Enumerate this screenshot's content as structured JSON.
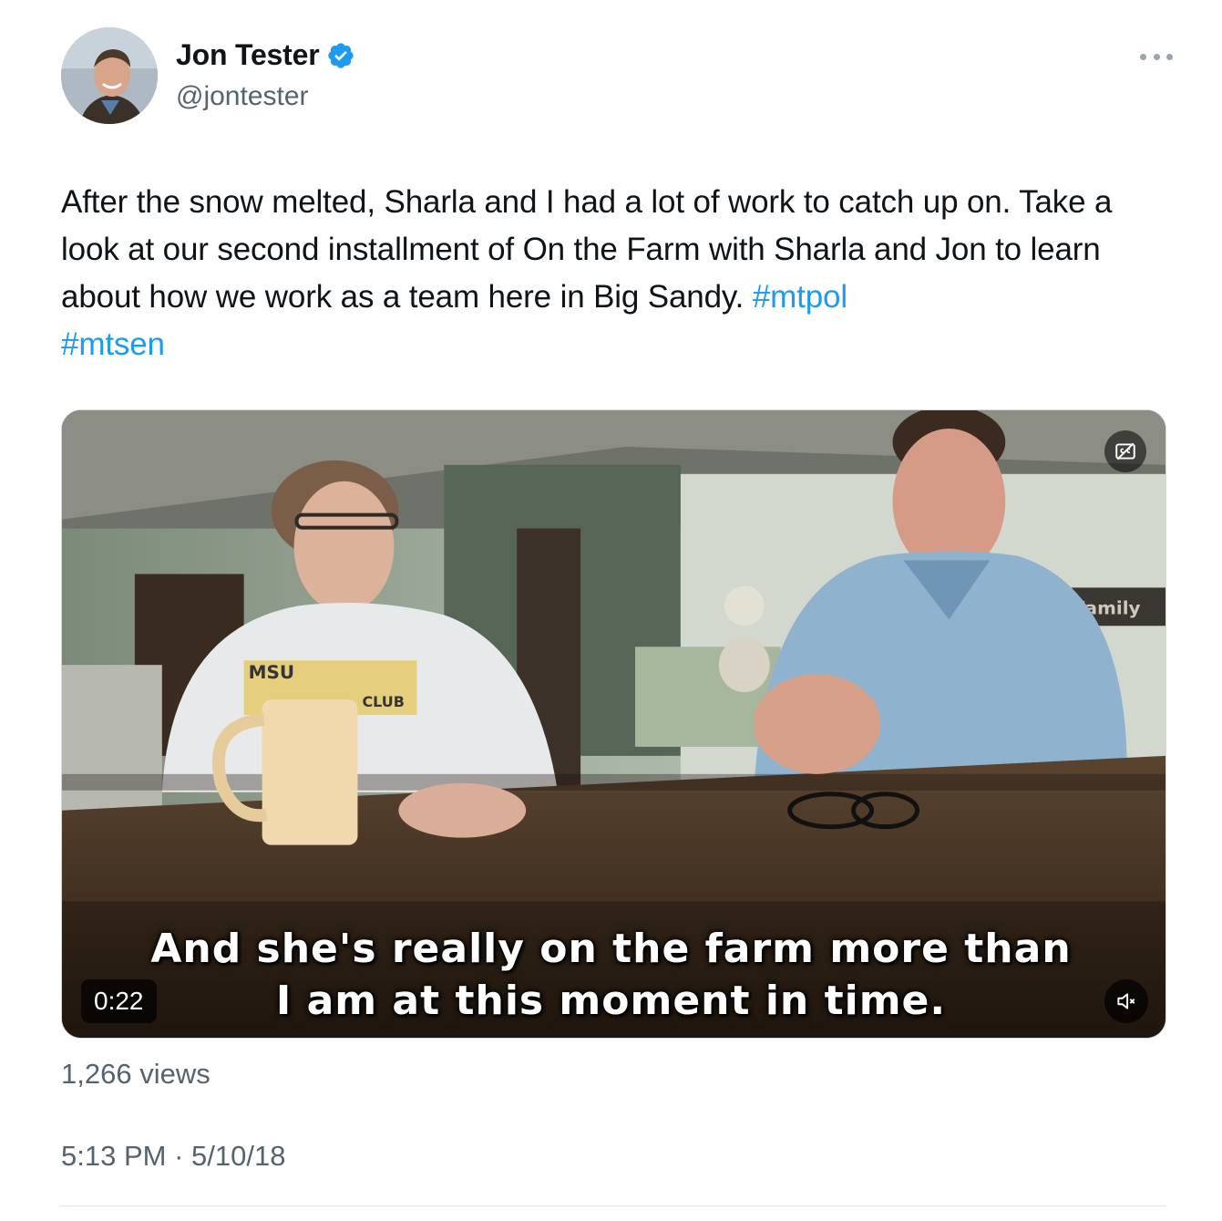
{
  "author": {
    "display_name": "Jon Tester",
    "handle": "@jontester",
    "verified": true,
    "verified_color": "#1d9bf0"
  },
  "tweet": {
    "text_plain": "After the snow melted, Sharla and I had a lot of work to catch up on. Take a look at our second installment of On the Farm with Sharla and Jon to learn about how we work as a team here in Big Sandy.",
    "hashtags": [
      "#mtpol",
      "#mtsen"
    ]
  },
  "media": {
    "caption_line_1": "And she's really on the farm more than",
    "caption_line_2": "I am at this moment in time.",
    "duration": "0:22",
    "shirt_text": "MSU",
    "shirt_text_2": "CLUB",
    "wall_sign": "Family"
  },
  "stats": {
    "views": "1,266 views"
  },
  "meta": {
    "time": "5:13 PM",
    "separator": "·",
    "date": "5/10/18"
  },
  "colors": {
    "link": "#1d9bf0",
    "secondary_text": "#536471",
    "primary_text": "#0f1419"
  }
}
